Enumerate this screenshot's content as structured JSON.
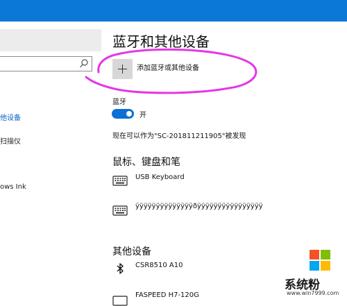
{
  "sidebar": {
    "search_placeholder": "",
    "items": [
      {
        "label": "他设备",
        "active": true
      },
      {
        "label": "扫描仪",
        "active": false
      },
      {
        "label": "ows Ink",
        "active": false
      }
    ]
  },
  "main": {
    "title": "蓝牙和其他设备",
    "add_button": {
      "icon": "plus-icon",
      "label": "添加蓝牙或其他设备"
    },
    "bluetooth": {
      "label": "蓝牙",
      "state": "开",
      "on": true
    },
    "discoverable_text": "现在可以作为\"SC-201811211905\"被发现",
    "mouse_keyboard": {
      "title": "鼠标、键盘和笔",
      "devices": [
        {
          "icon": "keyboard-icon",
          "name": "USB Keyboard"
        },
        {
          "icon": "keyboard-icon",
          "name": "ÿÿÿÿÿÿÿÿÿÿÿÿÿÿðÿÿÿÿÿÿÿÿÿÿÿÿÿÿÿÿ"
        }
      ]
    },
    "other_devices": {
      "title": "其他设备",
      "devices": [
        {
          "icon": "bluetooth-icon",
          "name": "CSR8510 A10"
        },
        {
          "icon": "keyboard-icon",
          "name": "FASPEED H7-120G"
        }
      ]
    }
  },
  "watermark": {
    "brand": "系统粉",
    "url": "www.win7999.com"
  },
  "colors": {
    "title_bar": "#0b78d7",
    "accent": "#0b6fd3",
    "annotation": "#e436e6"
  }
}
